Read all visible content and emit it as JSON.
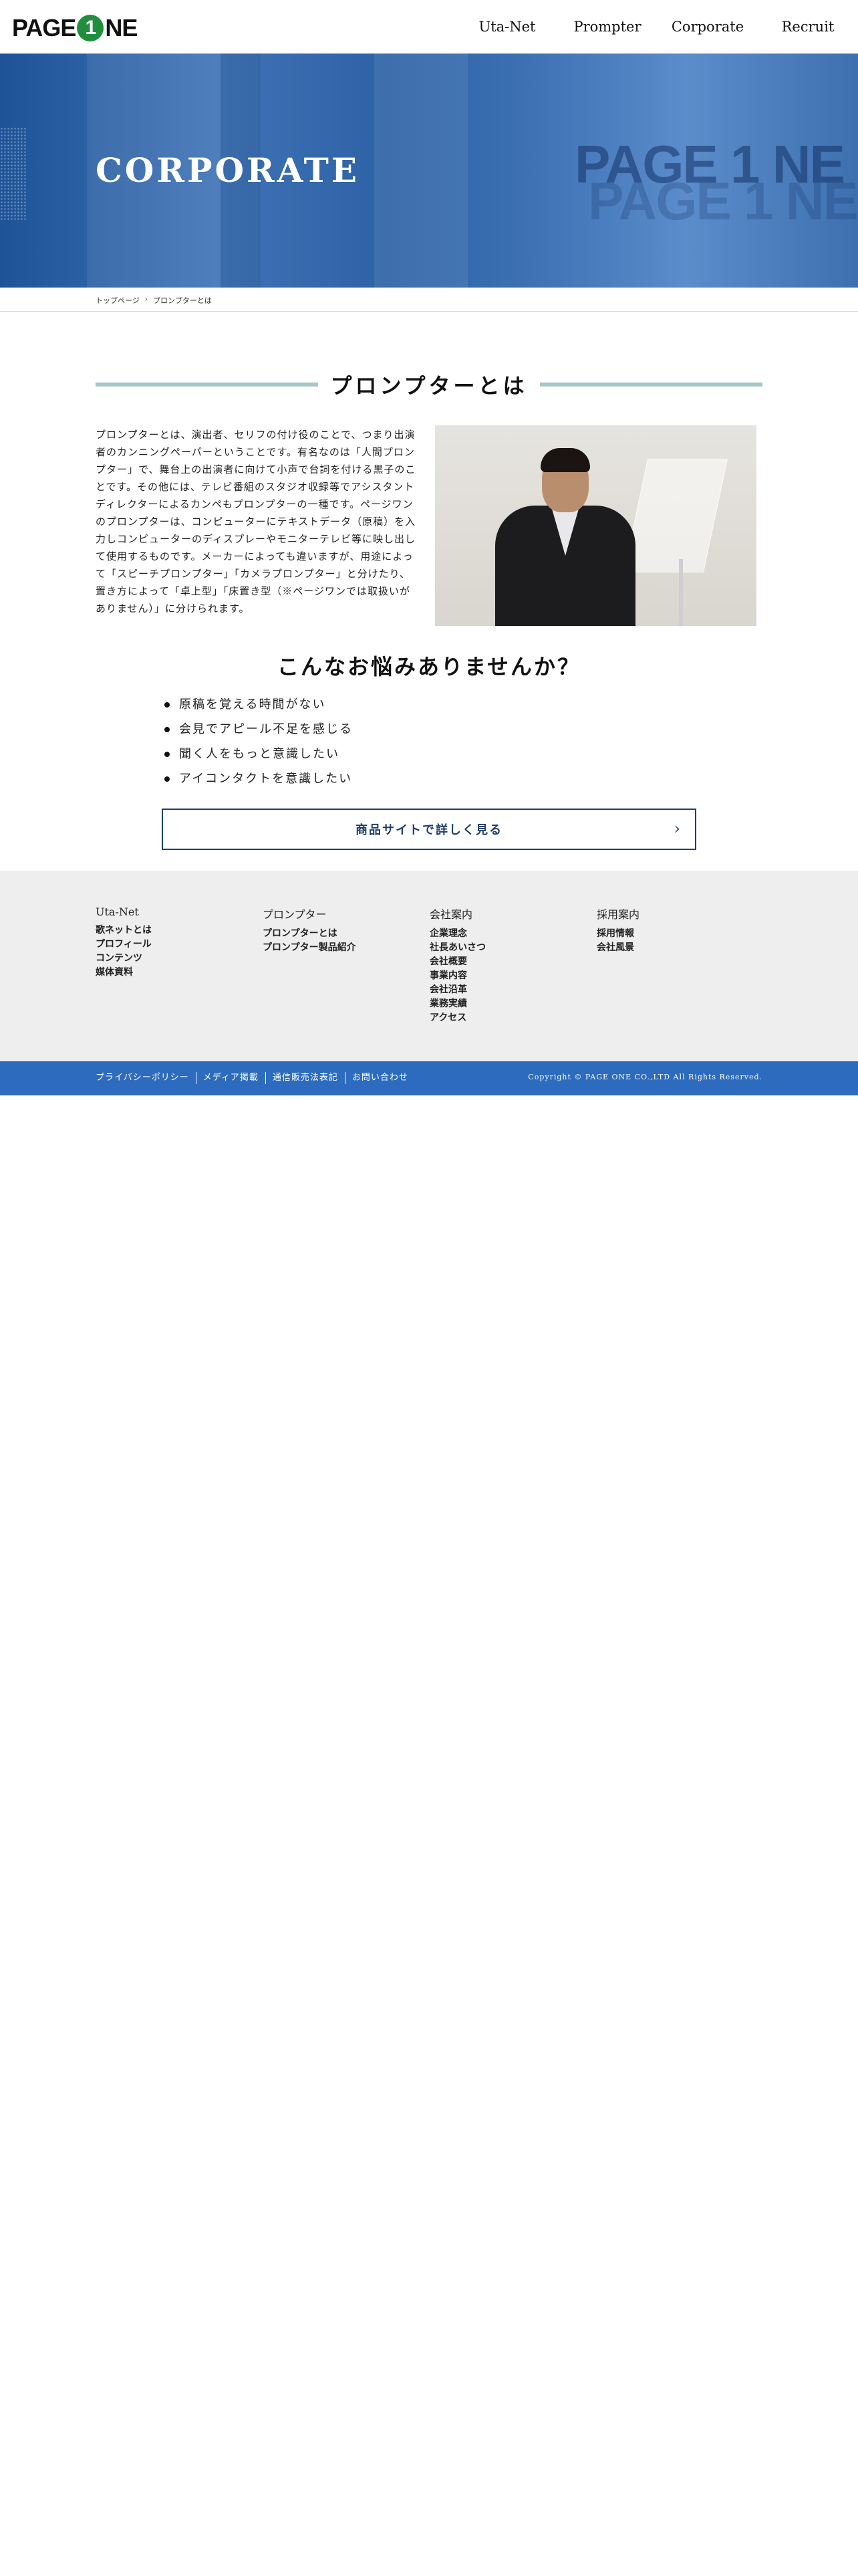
{
  "header": {
    "logo_left": "PAGE",
    "logo_circle": "1",
    "logo_right": "NE",
    "nav": [
      "Uta-Net",
      "Prompter",
      "Corporate",
      "Recruit"
    ]
  },
  "hero": {
    "title": "CORPORATE",
    "logo_text": "PAGE 1 NE"
  },
  "breadcrumb": {
    "home": "トップページ",
    "separator": "›",
    "current": "プロンプターとは"
  },
  "section": {
    "title": "プロンプターとは",
    "intro": "プロンプターとは、演出者、セリフの付け役のことで、つまり出演者のカンニングペーパーということです。有名なのは「人間プロンプター」で、舞台上の出演者に向けて小声で台詞を付ける黒子のことです。その他には、テレビ番組のスタジオ収録等でアシスタントディレクターによるカンペもプロンプターの一種です。ページワンのプロンプターは、コンピューターにテキストデータ（原稿）を入力しコンピューターのディスプレーやモニターテレビ等に映し出して使用するものです。メーカーによっても違いますが、用途によって「スピーチプロンプター」「カメラプロンプター」と分けたり、置き方によって「卓上型」「床置き型（※ページワンでは取扱いがありません）」に分けられます。"
  },
  "worries": {
    "title": "こんなお悩みありませんか？",
    "items": [
      "原稿を覚える時間がない",
      "会見でアピール不足を感じる",
      "聞く人をもっと意識したい",
      "アイコンタクトを意識したい"
    ]
  },
  "cta": {
    "label": "商品サイトで詳しく見る",
    "arrow": "›"
  },
  "footer": {
    "columns": [
      {
        "head": "Uta-Net",
        "items": [
          "歌ネットとは",
          "プロフィール",
          "コンテンツ",
          "媒体資料"
        ]
      },
      {
        "head": "プロンプター",
        "items": [
          "プロンプターとは",
          "プロンプター製品紹介"
        ]
      },
      {
        "head": "会社案内",
        "items": [
          "企業理念",
          "社長あいさつ",
          "会社概要",
          "事業内容",
          "会社沿革",
          "業務実績",
          "アクセス"
        ]
      },
      {
        "head": "採用案内",
        "items": [
          "採用情報",
          "会社風景"
        ]
      }
    ],
    "bottom_links": [
      "プライバシーポリシー",
      "メディア掲載",
      "通信販売法表記",
      "お問い合わせ"
    ],
    "copyright": "Copyright © PAGE ONE CO.,LTD All Rights Reserved."
  },
  "colors": {
    "brand_green": "#1f8f3e",
    "hero_blue": "#2e62a6",
    "heading_bar": "#a7c6c7",
    "cta_border": "#1f3f6b",
    "footer_bg": "#eeeeee",
    "bottom_bar": "#2c6bbd"
  }
}
